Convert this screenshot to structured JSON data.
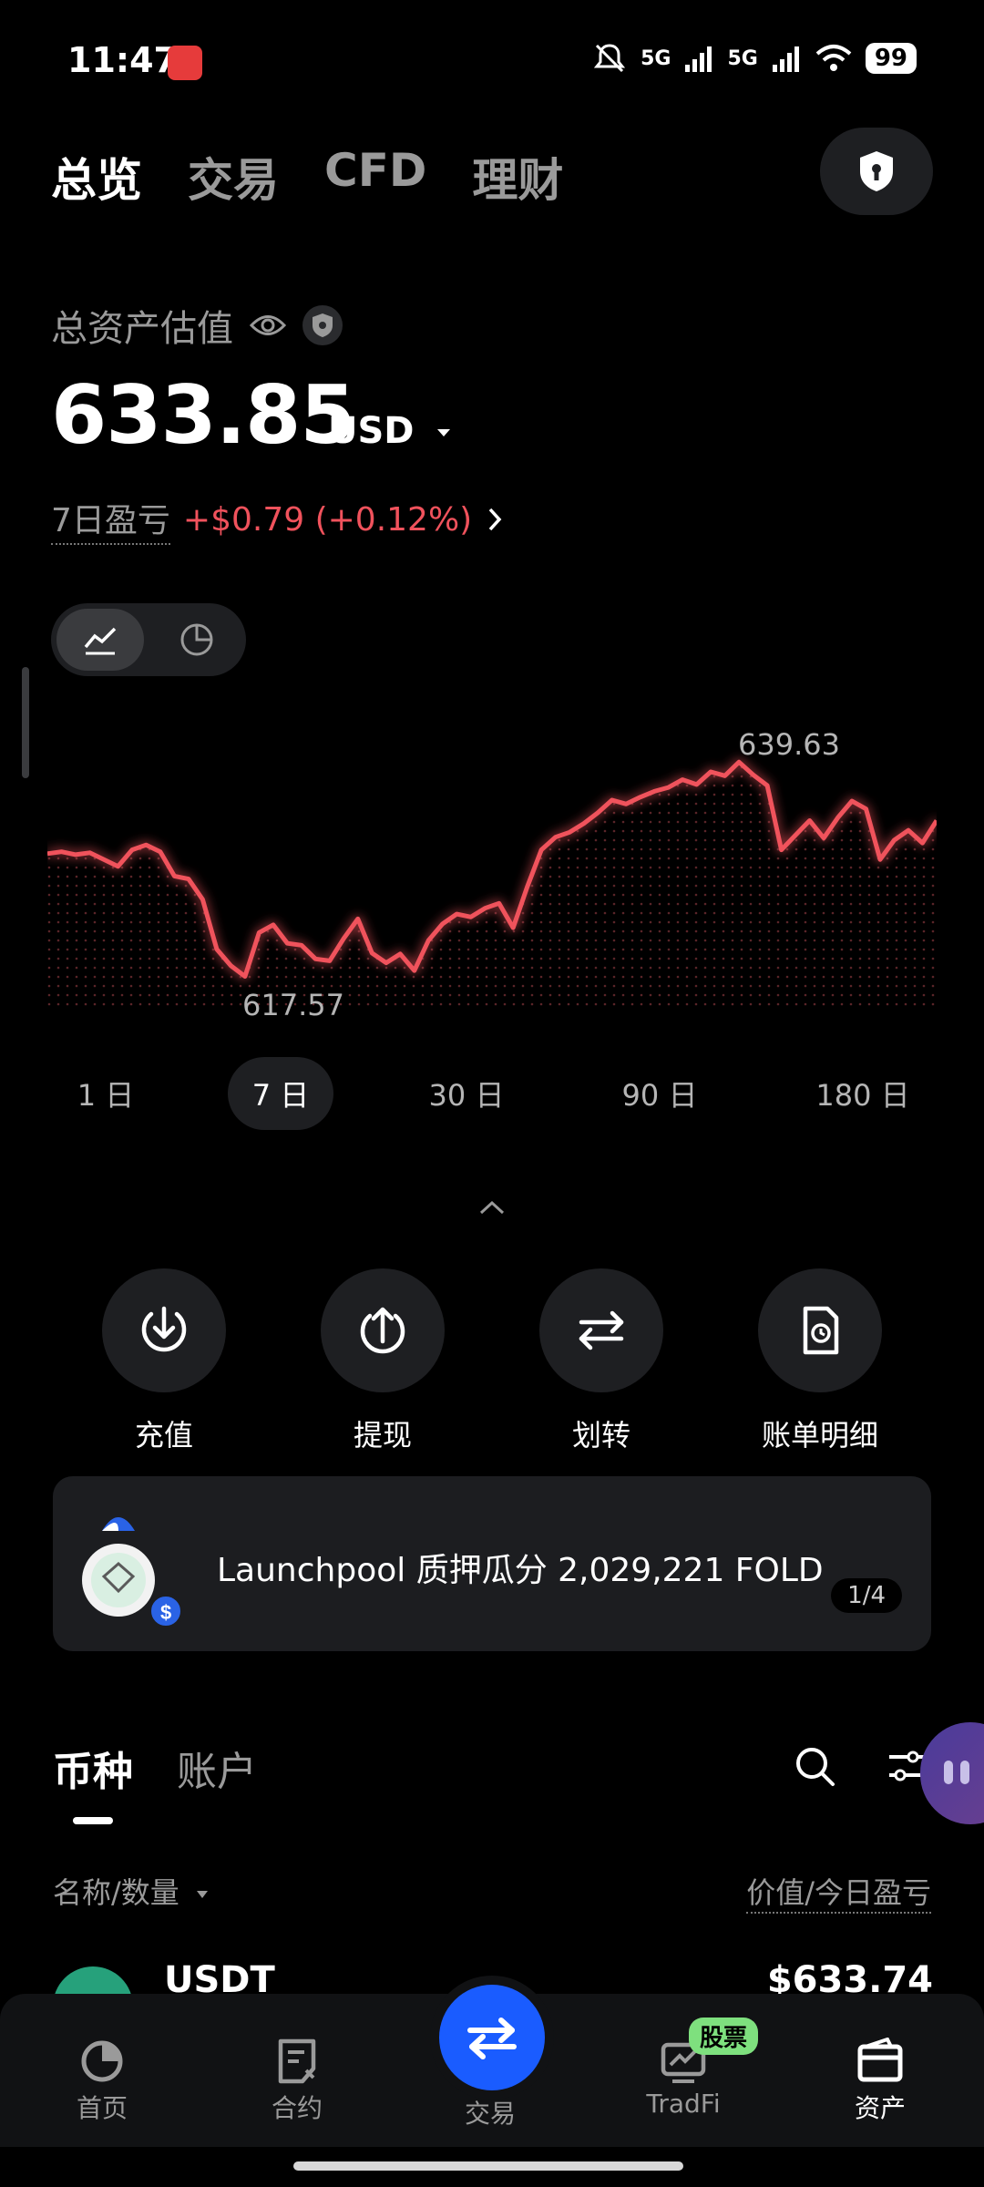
{
  "status_bar": {
    "time": "11:47",
    "network_1": "5G",
    "network_2": "5G",
    "battery": "99"
  },
  "top_tabs": [
    "总览",
    "交易",
    "CFD",
    "理财"
  ],
  "assets": {
    "label": "总资产估值",
    "amount": "633.85",
    "currency": "USD",
    "pnl_label": "7日盈亏",
    "pnl_value": "+$0.79 (+0.12%)"
  },
  "chart_data": {
    "type": "line",
    "high_label": "639.63",
    "low_label": "617.57",
    "series": [
      {
        "values": [
          630.2,
          630.4,
          630.1,
          630.3,
          629.6,
          628.9,
          630.6,
          631.1,
          630.4,
          627.9,
          627.6,
          625.5,
          620.4,
          618.7,
          617.6,
          622.1,
          622.9,
          621.0,
          620.8,
          619.4,
          619.2,
          621.5,
          623.5,
          620.0,
          619.0,
          619.9,
          618.2,
          621.3,
          623.0,
          624.0,
          623.7,
          624.6,
          625.1,
          622.6,
          626.8,
          630.6,
          631.9,
          632.4,
          633.3,
          634.4,
          635.7,
          635.3,
          636.0,
          636.6,
          637.0,
          637.8,
          637.3,
          638.6,
          638.2,
          639.6,
          638.3,
          637.2,
          630.6,
          632.1,
          633.6,
          631.8,
          633.9,
          635.6,
          634.8,
          629.6,
          631.6,
          632.6,
          631.3,
          633.6
        ]
      }
    ],
    "ylim": [
      614,
      643
    ],
    "color": "#f0525c"
  },
  "ranges": [
    "1 日",
    "7 日",
    "30 日",
    "90 日",
    "180 日"
  ],
  "active_range": "7 日",
  "actions": [
    {
      "label": "充值",
      "icon": "download-icon"
    },
    {
      "label": "提现",
      "icon": "upload-icon"
    },
    {
      "label": "划转",
      "icon": "transfer-icon"
    },
    {
      "label": "账单明细",
      "icon": "bill-icon"
    }
  ],
  "banner": {
    "text": "Launchpool 质押瓜分 2,029,221 FOLD",
    "page": "1/4"
  },
  "list_tabs": [
    "币种",
    "账户"
  ],
  "columns": {
    "name": "名称/数量",
    "value": "价值/今日盈亏"
  },
  "coin_row": {
    "name": "USDT",
    "value": "$633.74",
    "icon_color": "#26a17b"
  },
  "bottom_nav": [
    {
      "label": "首页",
      "icon": "home-icon"
    },
    {
      "label": "合约",
      "icon": "contract-icon"
    },
    {
      "label": "交易",
      "icon": "trade-icon"
    },
    {
      "label": "TradFi",
      "icon": "tradfi-icon",
      "badge": "股票"
    },
    {
      "label": "资产",
      "icon": "wallet-icon"
    }
  ],
  "colors": {
    "accent_red": "#f0525c",
    "brand_blue": "#1a5cff",
    "badge_green": "#7ee07e"
  }
}
